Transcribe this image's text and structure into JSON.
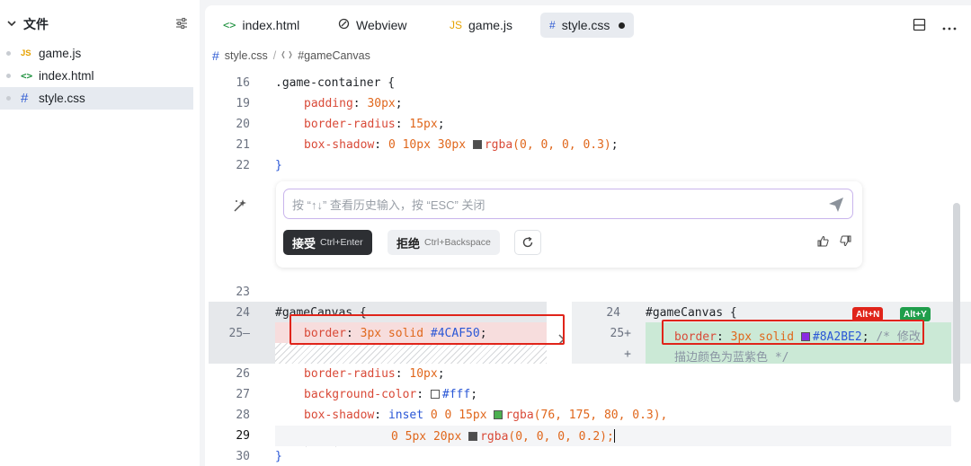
{
  "sidebar": {
    "title": "文件",
    "files": [
      {
        "icon": "JS",
        "name": "game.js"
      },
      {
        "icon": "<>",
        "name": "index.html"
      },
      {
        "icon": "#",
        "name": "style.css"
      }
    ]
  },
  "tabs": [
    {
      "icon": "<>",
      "label": "index.html"
    },
    {
      "icon": "webview-icon",
      "label": "Webview"
    },
    {
      "icon": "JS",
      "label": "game.js"
    },
    {
      "icon": "#",
      "label": "style.css"
    }
  ],
  "breadcrumb": {
    "file": "style.css",
    "sep": "/",
    "symbol": "#gameCanvas"
  },
  "code_top": [
    {
      "ln": "16",
      "text": ".game-container {"
    },
    {
      "ln": "19",
      "prop": "padding",
      "val": "30px"
    },
    {
      "ln": "20",
      "prop": "border-radius",
      "val": "15px"
    },
    {
      "ln": "21",
      "prop": "box-shadow",
      "val": "0 10px 30px ",
      "swatch": "#4d4d4d",
      "fn": "rgba",
      "args": "(0, 0, 0, 0.3)"
    },
    {
      "ln": "22",
      "text": "}"
    }
  ],
  "ai_panel": {
    "placeholder": "按 “↑↓” 查看历史输入，按 “ESC” 关闭",
    "accept_label": "接受",
    "accept_shortcut": "Ctrl+Enter",
    "reject_label": "拒绝",
    "reject_shortcut": "Ctrl+Backspace"
  },
  "diff": {
    "ln_23": "23",
    "left": {
      "ln_a": "24",
      "text_a": "#gameCanvas {",
      "ln_b": "25",
      "marker_b": "—",
      "prop": "border",
      "val": "3px solid ",
      "color": "#4CAF50"
    },
    "right": {
      "ln_a": "24",
      "text_a": "#gameCanvas {",
      "ln_b": "25",
      "marker_b": "+",
      "marker_c": "+",
      "prop": "border",
      "val": "3px solid ",
      "swatch": "#8A2BE2",
      "color": "#8A2BE2",
      "comment_1": "/* 修改",
      "comment_2": "描边颜色为蓝紫色 */"
    },
    "badge_reject": "Alt+N",
    "badge_accept": "Alt+Y"
  },
  "code_bottom": [
    {
      "ln": "26",
      "prop": "border-radius",
      "val": "10px"
    },
    {
      "ln": "27",
      "prop": "background-color",
      "swatch": "#ffffff",
      "val": "#fff"
    },
    {
      "ln": "28",
      "prop": "box-shadow",
      "kw": "inset",
      "val": " 0 0 15px ",
      "swatch": "#4caf50",
      "fn": "rgba",
      "args": "(76, 175, 80, 0.3),"
    },
    {
      "ln": "29",
      "val": "0 5px 20px ",
      "swatch": "#4d4d4d",
      "fn": "rgba",
      "args": "(0, 0, 0, 0.2);"
    },
    {
      "ln": "30",
      "text": "}"
    }
  ]
}
